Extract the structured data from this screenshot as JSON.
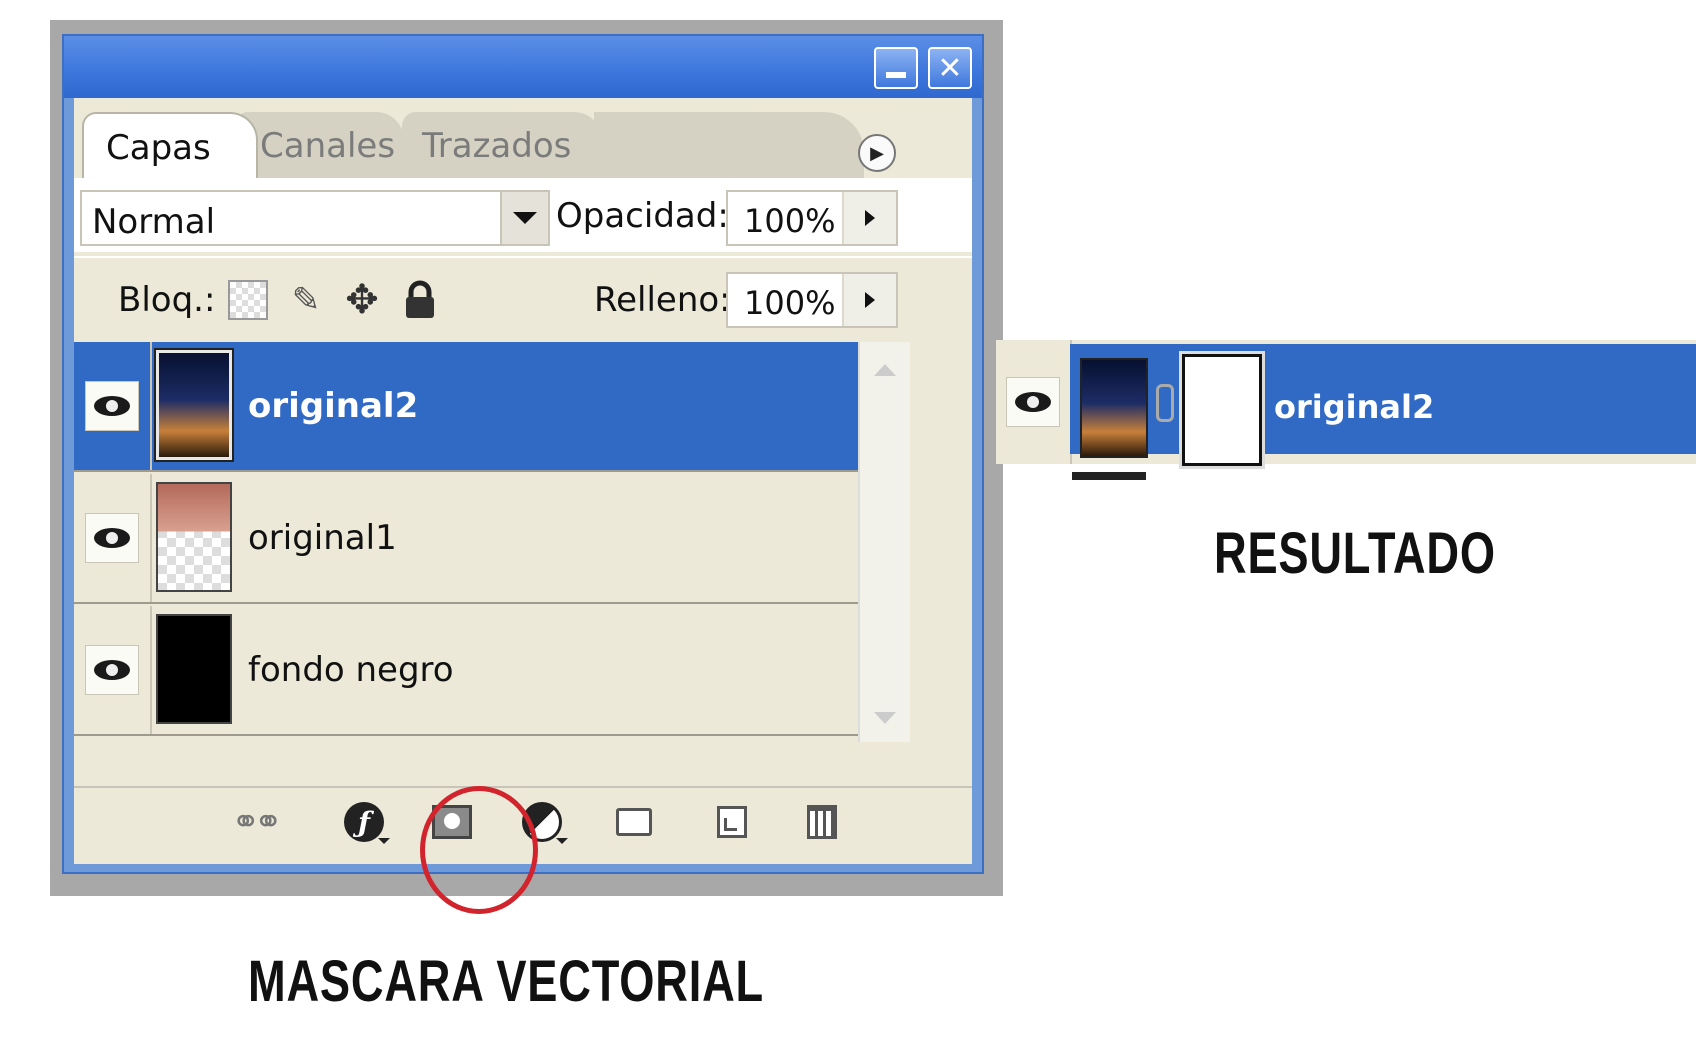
{
  "panel": {
    "tabs": [
      "Capas",
      "Canales",
      "Trazados"
    ],
    "blend_mode": "Normal",
    "opacity_label": "Opacidad:",
    "opacity_value": "100%",
    "lock_label": "Bloq.:",
    "fill_label": "Relleno:",
    "fill_value": "100%",
    "layers": [
      {
        "name": "original2",
        "visible": true,
        "selected": true,
        "thumbnail": "night-silhouette"
      },
      {
        "name": "original1",
        "visible": true,
        "selected": false,
        "thumbnail": "partial-image-over-transparency"
      },
      {
        "name": "fondo negro",
        "visible": true,
        "selected": false,
        "thumbnail": "solid-black"
      }
    ],
    "toolbar_icons": [
      "link-icon",
      "layer-style-icon",
      "vector-mask-icon",
      "adjustment-layer-icon",
      "folder-icon",
      "new-layer-icon",
      "trash-icon"
    ],
    "highlighted_tool": "vector-mask-icon"
  },
  "captions": {
    "mascara": "MASCARA VECTORIAL",
    "resultado": "RESULTADO"
  },
  "result": {
    "layer_name": "original2"
  },
  "colors": {
    "selection": "#316ac5",
    "highlight": "#d1242c",
    "title_bar": "#3c76dc",
    "panel_bg": "#ece9d8"
  }
}
